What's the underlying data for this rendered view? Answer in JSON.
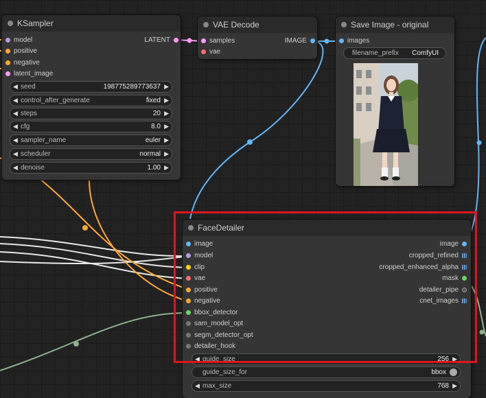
{
  "colors": {
    "model": "#b39ddb",
    "positive": "#ffa931",
    "negative": "#ffa931",
    "latent": "#ff9cf9",
    "vae": "#ff6e6e",
    "image": "#64b5f6",
    "clip": "#ffd500",
    "bbox": "#68d968",
    "generic": "#777777",
    "highlight": "#e0141e"
  },
  "ksampler": {
    "title": "KSampler",
    "inputs": [
      "model",
      "positive",
      "negative",
      "latent_image"
    ],
    "output": "LATENT",
    "widgets": [
      {
        "name": "seed",
        "value": "198775289773637"
      },
      {
        "name": "control_after_generate",
        "value": "fixed"
      },
      {
        "name": "steps",
        "value": "20"
      },
      {
        "name": "cfg",
        "value": "8.0"
      },
      {
        "name": "sampler_name",
        "value": "euler"
      },
      {
        "name": "scheduler",
        "value": "normal"
      },
      {
        "name": "denoise",
        "value": "1.00"
      }
    ]
  },
  "vae_decode": {
    "title": "VAE Decode",
    "inputs": [
      "samples",
      "vae"
    ],
    "output": "IMAGE"
  },
  "save_image": {
    "title": "Save Image - original",
    "input": "images",
    "filename_prefix_label": "filename_prefix",
    "filename_prefix_value": "ComfyUI"
  },
  "face_detailer": {
    "title": "FaceDetailer",
    "inputs": [
      "image",
      "model",
      "clip",
      "vae",
      "positive",
      "negative",
      "bbox_detector",
      "sam_model_opt",
      "segm_detector_opt",
      "detailer_hook"
    ],
    "outputs": [
      "image",
      "cropped_refined",
      "cropped_enhanced_alpha",
      "mask",
      "detailer_pipe",
      "cnet_images"
    ],
    "widgets": [
      {
        "name": "guide_size",
        "value": "256"
      },
      {
        "name": "guide_size_for",
        "value": "bbox"
      },
      {
        "name": "max_size",
        "value": "768"
      }
    ]
  }
}
